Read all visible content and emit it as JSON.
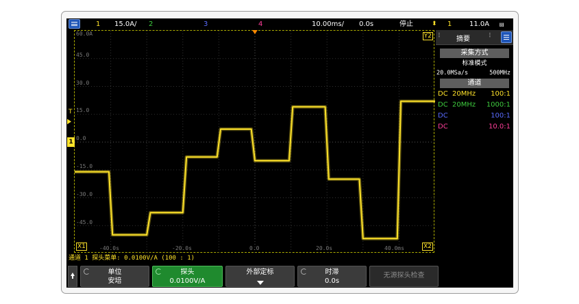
{
  "topbar": {
    "ch1_num": "1",
    "ch1_scale": "15.0A/",
    "ch2_num": "2",
    "ch3_num": "3",
    "ch4_num": "4",
    "timebase": "10.00ms/",
    "delay": "0.0s",
    "run_state": "停止",
    "trigger_icon": "trigger-edge-icon",
    "trig_channel": "1",
    "trig_level": "11.0A",
    "trig_slope_icon": "rising-edge-icon"
  },
  "plot": {
    "y_labels": [
      "60.0A",
      "45.0",
      "30.0",
      "15.0",
      "0.0",
      "-15.0",
      "-30.0",
      "-45.0"
    ],
    "x_labels": [
      "-40.0s",
      "-20.0s",
      "0.0",
      "20.0s",
      "40.0ms"
    ],
    "marker_y2": "Y2",
    "marker_x1": "X1",
    "marker_x2": "X2",
    "trigger_marker": "T",
    "ch1_marker": "1"
  },
  "side": {
    "title": "摘要",
    "acq_heading": "采集方式",
    "acq_mode": "标准模式",
    "sample_rate": "20.0MSa/s",
    "bandwidth_label": "500MHz",
    "channels_heading": "通道",
    "channels": [
      {
        "coupling": "DC",
        "bw": "20MHz",
        "probe": "100:1",
        "color": "#ffe32a"
      },
      {
        "coupling": "DC",
        "bw": "20MHz",
        "probe": "1000:1",
        "color": "#3ecc3e"
      },
      {
        "coupling": "DC",
        "bw": "",
        "probe": "100:1",
        "color": "#5a6cff"
      },
      {
        "coupling": "DC",
        "bw": "",
        "probe": "10.0:1",
        "color": "#ff3f9a"
      }
    ]
  },
  "status_line": "通道 1 探头菜单: 0.0100V/A (100 : 1)",
  "softkeys": {
    "unit_title": "单位",
    "unit_value": "安培",
    "probe_title": "探头",
    "probe_value": "0.0100V/A",
    "ext_title": "外部定标",
    "skew_title": "时滞",
    "skew_value": "0.0s",
    "passive_check": "无源探头检查"
  },
  "colors": {
    "ch1": "#ffe32a",
    "ch2": "#3ecc3e",
    "ch3": "#5a6cff",
    "ch4": "#ff3f9a",
    "active_key": "#1f8a2e",
    "menu_blue": "#1f56b8"
  },
  "chart_data": {
    "type": "line",
    "title": "",
    "xlabel": "",
    "ylabel": "",
    "xlim": [
      -50,
      50
    ],
    "ylim": [
      -60,
      60
    ],
    "series": [
      {
        "x": [
          -50,
          -40.5,
          -39.5,
          -30,
          -29,
          -20,
          -19,
          -10.5,
          -9.5,
          -1,
          0,
          9.5,
          10.5,
          19.5,
          20.5,
          29,
          30,
          39.5,
          40.5,
          50
        ],
        "y": [
          -16,
          -16,
          -50,
          -50,
          -38,
          -38,
          -8,
          -8,
          7,
          7,
          -10,
          -10,
          19,
          19,
          -20,
          -20,
          -52,
          -52,
          22,
          22
        ]
      }
    ]
  }
}
